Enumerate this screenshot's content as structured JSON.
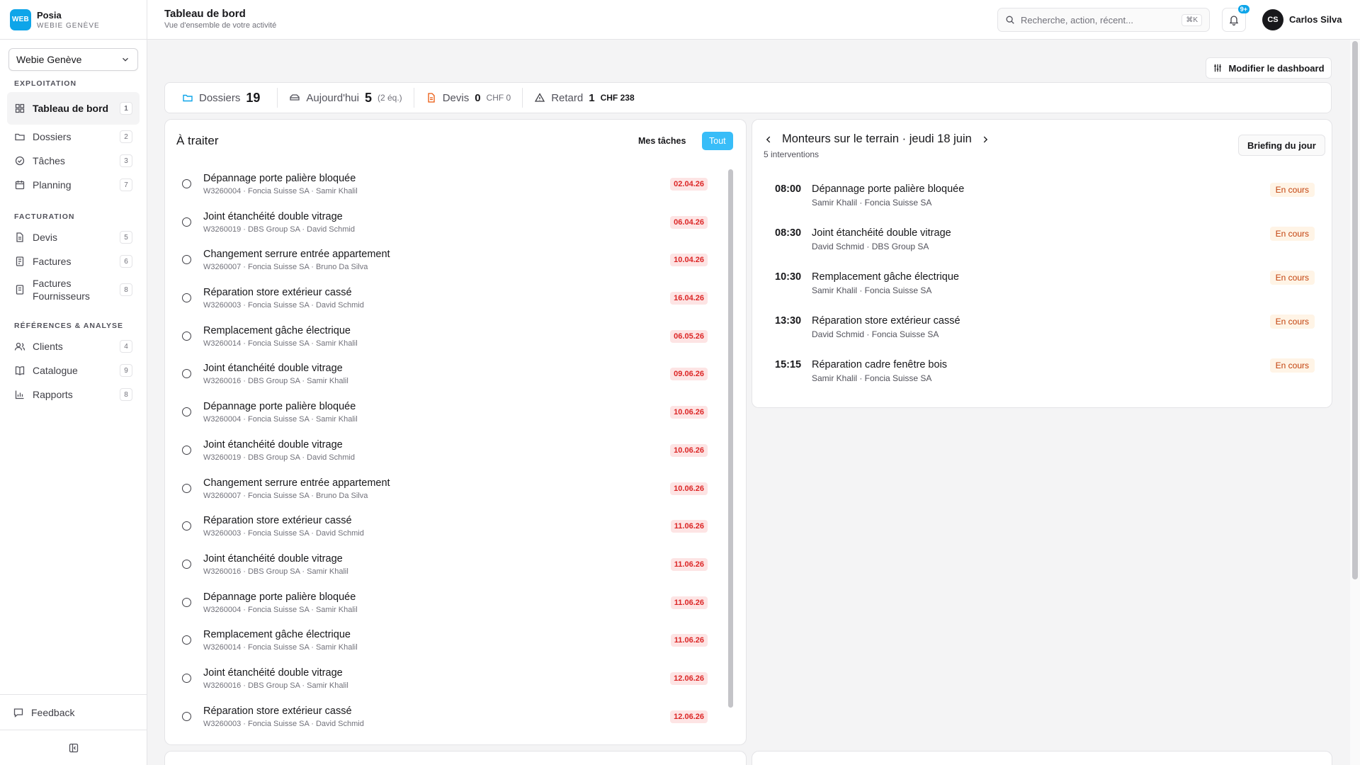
{
  "brand": {
    "logo": "WEB",
    "name": "Posia",
    "sub": "WEBIE GENÈVE"
  },
  "org_select": {
    "value": "Webie Genève"
  },
  "nav": {
    "sections": [
      {
        "title": "EXPLOITATION",
        "items": [
          {
            "label": "Tableau de bord",
            "key": "1",
            "icon": "dashboard-icon",
            "active": true
          },
          {
            "label": "Dossiers",
            "key": "2",
            "icon": "folder-icon"
          },
          {
            "label": "Tâches",
            "key": "3",
            "icon": "tasks-icon"
          },
          {
            "label": "Planning",
            "key": "7",
            "icon": "calendar-icon"
          }
        ]
      },
      {
        "title": "FACTURATION",
        "items": [
          {
            "label": "Devis",
            "key": "5",
            "icon": "quote-icon"
          },
          {
            "label": "Factures",
            "key": "6",
            "icon": "invoice-icon"
          },
          {
            "label": "Factures Fournisseurs",
            "key": "8",
            "icon": "supplier-invoice-icon"
          }
        ]
      },
      {
        "title": "RÉFÉRENCES & ANALYSE",
        "items": [
          {
            "label": "Clients",
            "key": "4",
            "icon": "users-icon"
          },
          {
            "label": "Catalogue",
            "key": "9",
            "icon": "book-icon"
          },
          {
            "label": "Rapports",
            "key": "8",
            "icon": "chart-icon"
          }
        ]
      }
    ]
  },
  "feedback": {
    "label": "Feedback"
  },
  "header": {
    "title": "Tableau de bord",
    "subtitle": "Vue d'ensemble de votre activité"
  },
  "search": {
    "placeholder": "Recherche, action, récent...",
    "shortcut": "⌘K"
  },
  "notifications": {
    "badge": "9+"
  },
  "user": {
    "initials": "CS",
    "name": "Carlos Silva"
  },
  "modify_button": {
    "label": "Modifier le dashboard"
  },
  "stats": {
    "dossiers": {
      "label": "Dossiers",
      "value": "19"
    },
    "today": {
      "label": "Aujourd'hui",
      "value": "5",
      "extra": "(2 éq.)"
    },
    "devis": {
      "label": "Devis",
      "value": "0",
      "extra": "CHF 0"
    },
    "retard": {
      "label": "Retard",
      "value": "1",
      "extra": "CHF 238"
    }
  },
  "todo": {
    "title": "À traiter",
    "filter_mine": "Mes tâches",
    "filter_all": "Tout",
    "tasks": [
      {
        "title": "Dépannage porte palière bloquée",
        "meta": "W3260004 · Foncia Suisse SA · Samir Khalil",
        "date": "02.04.26"
      },
      {
        "title": "Joint étanchéité double vitrage",
        "meta": "W3260019 · DBS Group SA · David Schmid",
        "date": "06.04.26"
      },
      {
        "title": "Changement serrure entrée appartement",
        "meta": "W3260007 · Foncia Suisse SA · Bruno Da Silva",
        "date": "10.04.26"
      },
      {
        "title": "Réparation store extérieur cassé",
        "meta": "W3260003 · Foncia Suisse SA · David Schmid",
        "date": "16.04.26"
      },
      {
        "title": "Remplacement gâche électrique",
        "meta": "W3260014 · Foncia Suisse SA · Samir Khalil",
        "date": "06.05.26"
      },
      {
        "title": "Joint étanchéité double vitrage",
        "meta": "W3260016 · DBS Group SA · Samir Khalil",
        "date": "09.06.26"
      },
      {
        "title": "Dépannage porte palière bloquée",
        "meta": "W3260004 · Foncia Suisse SA · Samir Khalil",
        "date": "10.06.26"
      },
      {
        "title": "Joint étanchéité double vitrage",
        "meta": "W3260019 · DBS Group SA · David Schmid",
        "date": "10.06.26"
      },
      {
        "title": "Changement serrure entrée appartement",
        "meta": "W3260007 · Foncia Suisse SA · Bruno Da Silva",
        "date": "10.06.26"
      },
      {
        "title": "Réparation store extérieur cassé",
        "meta": "W3260003 · Foncia Suisse SA · David Schmid",
        "date": "11.06.26"
      },
      {
        "title": "Joint étanchéité double vitrage",
        "meta": "W3260016 · DBS Group SA · Samir Khalil",
        "date": "11.06.26"
      },
      {
        "title": "Dépannage porte palière bloquée",
        "meta": "W3260004 · Foncia Suisse SA · Samir Khalil",
        "date": "11.06.26"
      },
      {
        "title": "Remplacement gâche électrique",
        "meta": "W3260014 · Foncia Suisse SA · Samir Khalil",
        "date": "11.06.26"
      },
      {
        "title": "Joint étanchéité double vitrage",
        "meta": "W3260016 · DBS Group SA · Samir Khalil",
        "date": "12.06.26"
      },
      {
        "title": "Réparation store extérieur cassé",
        "meta": "W3260003 · Foncia Suisse SA · David Schmid",
        "date": "12.06.26"
      }
    ]
  },
  "field": {
    "title": "Monteurs sur le terrain · jeudi 18 juin",
    "count": "5 interventions",
    "briefing": "Briefing du jour",
    "interventions": [
      {
        "time": "08:00",
        "title": "Dépannage porte palière bloquée",
        "meta": "Samir Khalil · Foncia Suisse SA",
        "status": "En cours"
      },
      {
        "time": "08:30",
        "title": "Joint étanchéité double vitrage",
        "meta": "David Schmid · DBS Group SA",
        "status": "En cours"
      },
      {
        "time": "10:30",
        "title": "Remplacement gâche électrique",
        "meta": "Samir Khalil · Foncia Suisse SA",
        "status": "En cours"
      },
      {
        "time": "13:30",
        "title": "Réparation store extérieur cassé",
        "meta": "David Schmid · Foncia Suisse SA",
        "status": "En cours"
      },
      {
        "time": "15:15",
        "title": "Réparation cadre fenêtre bois",
        "meta": "Samir Khalil · Foncia Suisse SA",
        "status": "En cours"
      }
    ]
  },
  "colors": {
    "accent": "#38bdf8",
    "brand": "#0ea5e9",
    "overdue_bg": "#fde4e4",
    "overdue_text": "#dc2626",
    "status_bg": "#fff4e6",
    "status_text": "#c2410c"
  }
}
